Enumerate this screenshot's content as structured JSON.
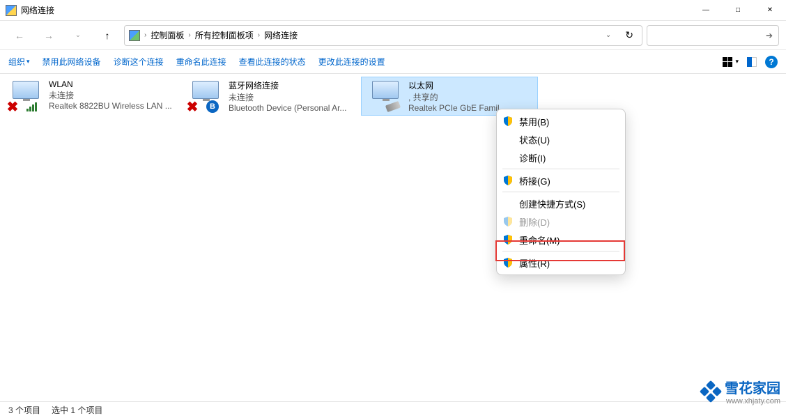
{
  "window": {
    "title": "网络连接"
  },
  "breadcrumb": {
    "items": [
      "控制面板",
      "所有控制面板项",
      "网络连接"
    ]
  },
  "toolbar": {
    "organize": "组织",
    "disable": "禁用此网络设备",
    "diagnose": "诊断这个连接",
    "rename": "重命名此连接",
    "view_status": "查看此连接的状态",
    "change_settings": "更改此连接的设置"
  },
  "connections": [
    {
      "name": "WLAN",
      "status": "未连接",
      "device": "Realtek 8822BU Wireless LAN ...",
      "type": "wifi",
      "disabled_x": true,
      "selected": false
    },
    {
      "name": "蓝牙网络连接",
      "status": "未连接",
      "device": "Bluetooth Device (Personal Ar...",
      "type": "bluetooth",
      "disabled_x": true,
      "selected": false
    },
    {
      "name": "以太网",
      "status": ", 共享的",
      "device": "Realtek PCIe GbE Famil...",
      "type": "ethernet",
      "disabled_x": false,
      "selected": true
    }
  ],
  "context_menu": {
    "disable": "禁用(B)",
    "status": "状态(U)",
    "diagnose": "诊断(I)",
    "bridge": "桥接(G)",
    "shortcut": "创建快捷方式(S)",
    "delete": "删除(D)",
    "rename": "重命名(M)",
    "properties": "属性(R)"
  },
  "statusbar": {
    "count": "3 个项目",
    "selected": "选中 1 个项目"
  },
  "watermark": {
    "brand": "雪花家园",
    "url": "www.xhjaty.com"
  }
}
